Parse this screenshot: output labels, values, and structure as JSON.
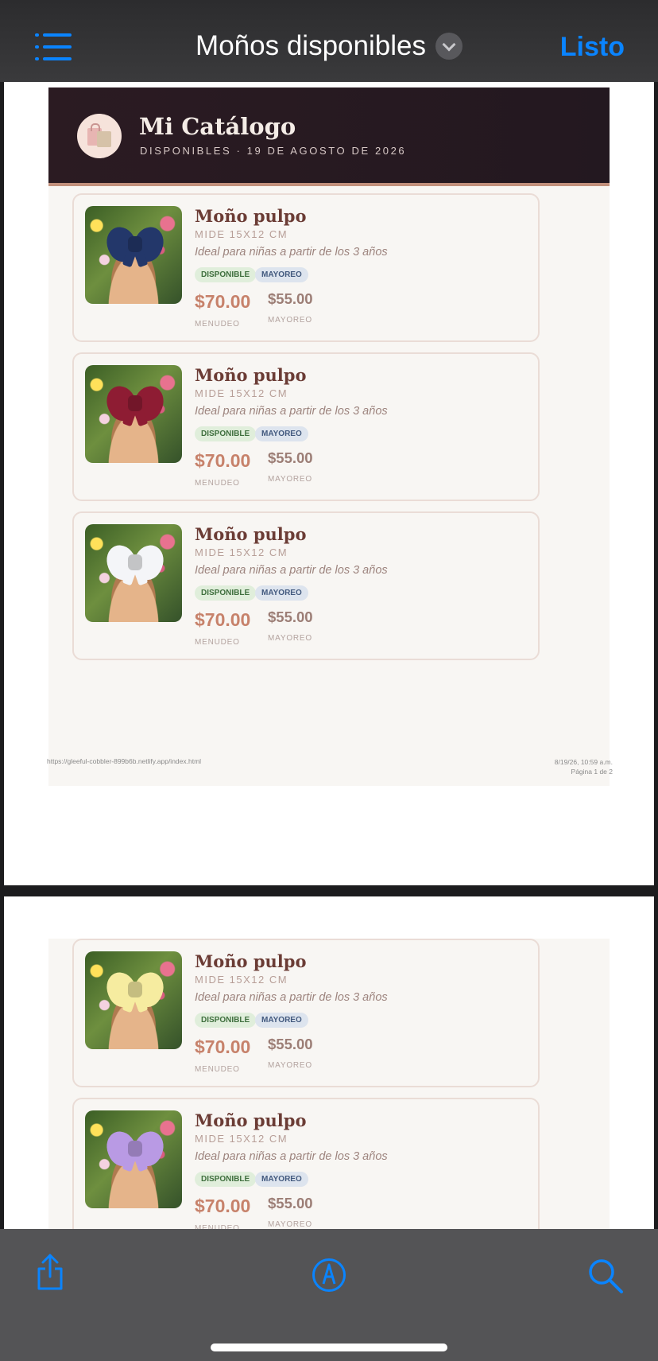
{
  "nav": {
    "title": "Moños disponibles",
    "done_label": "Listo"
  },
  "catalog": {
    "brand": "Mi Catálogo",
    "subtitle": "DISPONIBLES · 19 DE AGOSTO DE 2026"
  },
  "products": [
    {
      "name": "Moño pulpo",
      "size": "MIDE 15X12 CM",
      "desc": "Ideal para niñas a partir de los 3 años",
      "tag_available": "DISPONIBLE",
      "tag_wholesale": "MAYOREO",
      "price_retail": "$70.00",
      "retail_label": "MENUDEO",
      "price_wholesale": "$55.00",
      "wholesale_label": "MAYOREO",
      "bow_color": "#23376a"
    },
    {
      "name": "Moño pulpo",
      "size": "MIDE 15X12 CM",
      "desc": "Ideal para niñas a partir de los 3 años",
      "tag_available": "DISPONIBLE",
      "tag_wholesale": "MAYOREO",
      "price_retail": "$70.00",
      "retail_label": "MENUDEO",
      "price_wholesale": "$55.00",
      "wholesale_label": "MAYOREO",
      "bow_color": "#8e1c33"
    },
    {
      "name": "Moño pulpo",
      "size": "MIDE 15X12 CM",
      "desc": "Ideal para niñas a partir de los 3 años",
      "tag_available": "DISPONIBLE",
      "tag_wholesale": "MAYOREO",
      "price_retail": "$70.00",
      "retail_label": "MENUDEO",
      "price_wholesale": "$55.00",
      "wholesale_label": "MAYOREO",
      "bow_color": "#f4f5f8"
    },
    {
      "name": "Moño pulpo",
      "size": "MIDE 15X12 CM",
      "desc": "Ideal para niñas a partir de los 3 años",
      "tag_available": "DISPONIBLE",
      "tag_wholesale": "MAYOREO",
      "price_retail": "$70.00",
      "retail_label": "MENUDEO",
      "price_wholesale": "$55.00",
      "wholesale_label": "MAYOREO",
      "bow_color": "#f6eca0"
    },
    {
      "name": "Moño pulpo",
      "size": "MIDE 15X12 CM",
      "desc": "Ideal para niñas a partir de los 3 años",
      "tag_available": "DISPONIBLE",
      "tag_wholesale": "MAYOREO",
      "price_retail": "$70.00",
      "retail_label": "MENUDEO",
      "price_wholesale": "$55.00",
      "wholesale_label": "MAYOREO",
      "bow_color": "#b99ae4"
    }
  ],
  "footer": {
    "url": "https://gleeful-cobbler-899b6b.netlify.app/index.html",
    "datetime": "8/19/26, 10:59 a.m.",
    "page": "Página 1 de 2"
  },
  "toolbar": {
    "icons": [
      "list-icon",
      "share-icon",
      "markup-icon",
      "search-icon"
    ],
    "accent": "#0a84ff"
  }
}
